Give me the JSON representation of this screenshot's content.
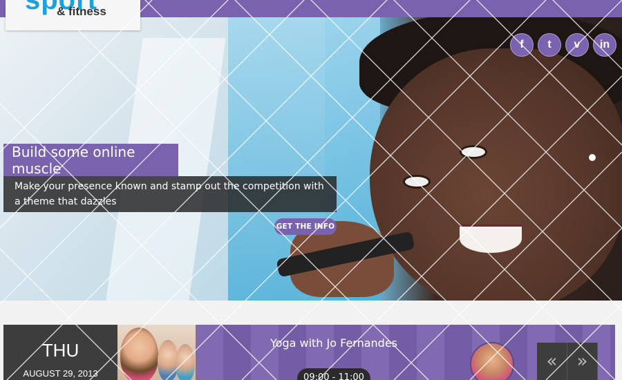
{
  "header": {
    "logo_text": "sport",
    "logo_sub": "& fitness"
  },
  "social": [
    {
      "icon": "facebook-icon",
      "glyph": "f"
    },
    {
      "icon": "twitter-icon",
      "glyph": "t"
    },
    {
      "icon": "vimeo-icon",
      "glyph": "v"
    },
    {
      "icon": "linkedin-icon",
      "glyph": "in"
    }
  ],
  "hero": {
    "title": "Build some online muscle",
    "text": "Make your presence known and stamp out the competition with a theme that dazzles",
    "cta": "GET THE INFO"
  },
  "event": {
    "day": "THU",
    "date": "AUGUST 29, 2013",
    "name": "Yoga with Jo Fernandes",
    "time": "09:00 - 11:00",
    "prev": "«",
    "next": "»"
  },
  "colors": {
    "accent": "#7a62ae",
    "dark": "#3d3d3d"
  }
}
